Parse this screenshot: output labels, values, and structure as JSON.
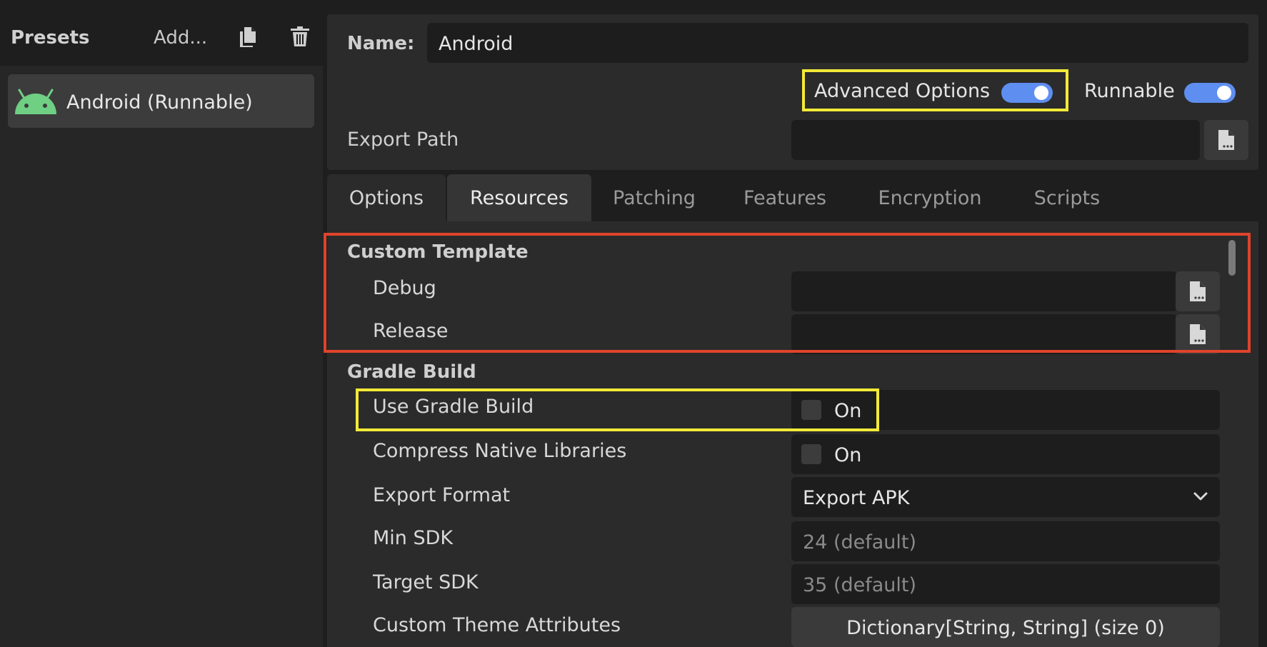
{
  "presets": {
    "title": "Presets",
    "add_label": "Add...",
    "items": [
      {
        "label": "Android (Runnable)",
        "icon": "android-icon"
      }
    ]
  },
  "header": {
    "name_label": "Name:",
    "name_value": "Android",
    "advanced_options_label": "Advanced Options",
    "advanced_options_on": true,
    "runnable_label": "Runnable",
    "runnable_on": true,
    "export_path_label": "Export Path",
    "export_path_value": ""
  },
  "tabs": [
    {
      "label": "Options"
    },
    {
      "label": "Resources",
      "active": true
    },
    {
      "label": "Patching"
    },
    {
      "label": "Features"
    },
    {
      "label": "Encryption"
    },
    {
      "label": "Scripts"
    }
  ],
  "custom_template": {
    "title": "Custom Template",
    "debug_label": "Debug",
    "debug_value": "",
    "release_label": "Release",
    "release_value": ""
  },
  "gradle_build": {
    "title": "Gradle Build",
    "use_gradle_label": "Use Gradle Build",
    "use_gradle_value": "On",
    "use_gradle_checked": false,
    "compress_label": "Compress Native Libraries",
    "compress_value": "On",
    "compress_checked": false,
    "export_format_label": "Export Format",
    "export_format_value": "Export APK",
    "min_sdk_label": "Min SDK",
    "min_sdk_placeholder": "24 (default)",
    "target_sdk_label": "Target SDK",
    "target_sdk_placeholder": "35 (default)",
    "custom_theme_label": "Custom Theme Attributes",
    "custom_theme_value": "Dictionary[String, String] (size 0)"
  },
  "colors": {
    "toggle_on": "#5e8ef0",
    "highlight_yellow": "#f2ea38",
    "highlight_red": "#e0432b",
    "android_green": "#6fcf83"
  }
}
